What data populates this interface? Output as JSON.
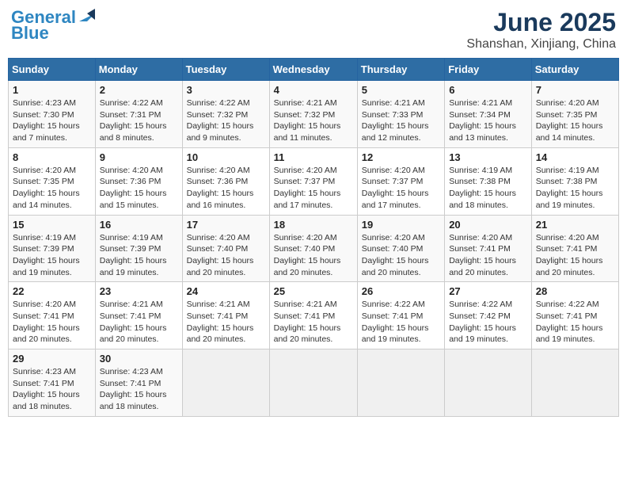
{
  "header": {
    "logo_line1": "General",
    "logo_line2": "Blue",
    "month": "June 2025",
    "location": "Shanshan, Xinjiang, China"
  },
  "weekdays": [
    "Sunday",
    "Monday",
    "Tuesday",
    "Wednesday",
    "Thursday",
    "Friday",
    "Saturday"
  ],
  "weeks": [
    [
      {
        "day": "1",
        "info": "Sunrise: 4:23 AM\nSunset: 7:30 PM\nDaylight: 15 hours\nand 7 minutes."
      },
      {
        "day": "2",
        "info": "Sunrise: 4:22 AM\nSunset: 7:31 PM\nDaylight: 15 hours\nand 8 minutes."
      },
      {
        "day": "3",
        "info": "Sunrise: 4:22 AM\nSunset: 7:32 PM\nDaylight: 15 hours\nand 9 minutes."
      },
      {
        "day": "4",
        "info": "Sunrise: 4:21 AM\nSunset: 7:32 PM\nDaylight: 15 hours\nand 11 minutes."
      },
      {
        "day": "5",
        "info": "Sunrise: 4:21 AM\nSunset: 7:33 PM\nDaylight: 15 hours\nand 12 minutes."
      },
      {
        "day": "6",
        "info": "Sunrise: 4:21 AM\nSunset: 7:34 PM\nDaylight: 15 hours\nand 13 minutes."
      },
      {
        "day": "7",
        "info": "Sunrise: 4:20 AM\nSunset: 7:35 PM\nDaylight: 15 hours\nand 14 minutes."
      }
    ],
    [
      {
        "day": "8",
        "info": "Sunrise: 4:20 AM\nSunset: 7:35 PM\nDaylight: 15 hours\nand 14 minutes."
      },
      {
        "day": "9",
        "info": "Sunrise: 4:20 AM\nSunset: 7:36 PM\nDaylight: 15 hours\nand 15 minutes."
      },
      {
        "day": "10",
        "info": "Sunrise: 4:20 AM\nSunset: 7:36 PM\nDaylight: 15 hours\nand 16 minutes."
      },
      {
        "day": "11",
        "info": "Sunrise: 4:20 AM\nSunset: 7:37 PM\nDaylight: 15 hours\nand 17 minutes."
      },
      {
        "day": "12",
        "info": "Sunrise: 4:20 AM\nSunset: 7:37 PM\nDaylight: 15 hours\nand 17 minutes."
      },
      {
        "day": "13",
        "info": "Sunrise: 4:19 AM\nSunset: 7:38 PM\nDaylight: 15 hours\nand 18 minutes."
      },
      {
        "day": "14",
        "info": "Sunrise: 4:19 AM\nSunset: 7:38 PM\nDaylight: 15 hours\nand 19 minutes."
      }
    ],
    [
      {
        "day": "15",
        "info": "Sunrise: 4:19 AM\nSunset: 7:39 PM\nDaylight: 15 hours\nand 19 minutes."
      },
      {
        "day": "16",
        "info": "Sunrise: 4:19 AM\nSunset: 7:39 PM\nDaylight: 15 hours\nand 19 minutes."
      },
      {
        "day": "17",
        "info": "Sunrise: 4:20 AM\nSunset: 7:40 PM\nDaylight: 15 hours\nand 20 minutes."
      },
      {
        "day": "18",
        "info": "Sunrise: 4:20 AM\nSunset: 7:40 PM\nDaylight: 15 hours\nand 20 minutes."
      },
      {
        "day": "19",
        "info": "Sunrise: 4:20 AM\nSunset: 7:40 PM\nDaylight: 15 hours\nand 20 minutes."
      },
      {
        "day": "20",
        "info": "Sunrise: 4:20 AM\nSunset: 7:41 PM\nDaylight: 15 hours\nand 20 minutes."
      },
      {
        "day": "21",
        "info": "Sunrise: 4:20 AM\nSunset: 7:41 PM\nDaylight: 15 hours\nand 20 minutes."
      }
    ],
    [
      {
        "day": "22",
        "info": "Sunrise: 4:20 AM\nSunset: 7:41 PM\nDaylight: 15 hours\nand 20 minutes."
      },
      {
        "day": "23",
        "info": "Sunrise: 4:21 AM\nSunset: 7:41 PM\nDaylight: 15 hours\nand 20 minutes."
      },
      {
        "day": "24",
        "info": "Sunrise: 4:21 AM\nSunset: 7:41 PM\nDaylight: 15 hours\nand 20 minutes."
      },
      {
        "day": "25",
        "info": "Sunrise: 4:21 AM\nSunset: 7:41 PM\nDaylight: 15 hours\nand 20 minutes."
      },
      {
        "day": "26",
        "info": "Sunrise: 4:22 AM\nSunset: 7:41 PM\nDaylight: 15 hours\nand 19 minutes."
      },
      {
        "day": "27",
        "info": "Sunrise: 4:22 AM\nSunset: 7:42 PM\nDaylight: 15 hours\nand 19 minutes."
      },
      {
        "day": "28",
        "info": "Sunrise: 4:22 AM\nSunset: 7:41 PM\nDaylight: 15 hours\nand 19 minutes."
      }
    ],
    [
      {
        "day": "29",
        "info": "Sunrise: 4:23 AM\nSunset: 7:41 PM\nDaylight: 15 hours\nand 18 minutes."
      },
      {
        "day": "30",
        "info": "Sunrise: 4:23 AM\nSunset: 7:41 PM\nDaylight: 15 hours\nand 18 minutes."
      },
      {
        "day": "",
        "info": ""
      },
      {
        "day": "",
        "info": ""
      },
      {
        "day": "",
        "info": ""
      },
      {
        "day": "",
        "info": ""
      },
      {
        "day": "",
        "info": ""
      }
    ]
  ]
}
